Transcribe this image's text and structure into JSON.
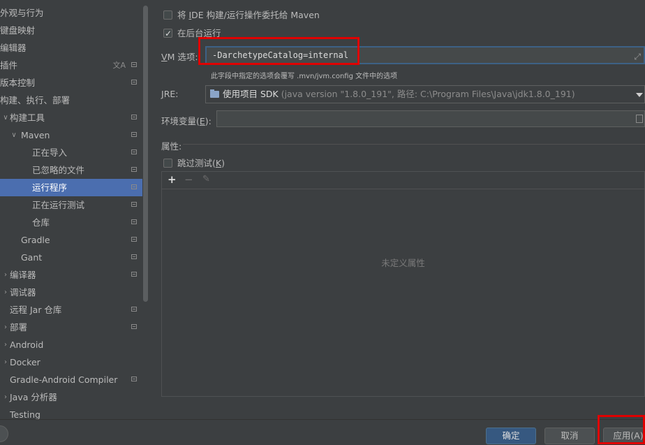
{
  "sidebar": {
    "items": [
      {
        "label": "外观与行为",
        "level": 0,
        "arrow": "",
        "proj": false
      },
      {
        "label": "键盘映射",
        "level": 0,
        "arrow": "",
        "proj": false
      },
      {
        "label": "编辑器",
        "level": 0,
        "arrow": "",
        "proj": false
      },
      {
        "label": "插件",
        "level": 0,
        "arrow": "",
        "proj": true,
        "translate": true
      },
      {
        "label": "版本控制",
        "level": 0,
        "arrow": "",
        "proj": true
      },
      {
        "label": "构建、执行、部署",
        "level": 0,
        "arrow": "",
        "proj": false
      },
      {
        "label": "构建工具",
        "level": 1,
        "arrow": "∨",
        "proj": true
      },
      {
        "label": "Maven",
        "level": 2,
        "arrow": "∨",
        "proj": true
      },
      {
        "label": "正在导入",
        "level": 3,
        "arrow": "",
        "proj": true
      },
      {
        "label": "已忽略的文件",
        "level": 3,
        "arrow": "",
        "proj": true
      },
      {
        "label": "运行程序",
        "level": 3,
        "arrow": "",
        "proj": true,
        "selected": true
      },
      {
        "label": "正在运行测试",
        "level": 3,
        "arrow": "",
        "proj": true
      },
      {
        "label": "仓库",
        "level": 3,
        "arrow": "",
        "proj": true
      },
      {
        "label": "Gradle",
        "level": 2,
        "arrow": "",
        "proj": true
      },
      {
        "label": "Gant",
        "level": 2,
        "arrow": "",
        "proj": true
      },
      {
        "label": "编译器",
        "level": 1,
        "arrow": "›",
        "proj": true
      },
      {
        "label": "调试器",
        "level": 1,
        "arrow": "›",
        "proj": false
      },
      {
        "label": "远程 Jar 仓库",
        "level": 1,
        "arrow": "",
        "proj": true
      },
      {
        "label": "部署",
        "level": 1,
        "arrow": "›",
        "proj": true
      },
      {
        "label": "Android",
        "level": 1,
        "arrow": "›",
        "proj": false
      },
      {
        "label": "Docker",
        "level": 1,
        "arrow": "›",
        "proj": false
      },
      {
        "label": "Gradle-Android Compiler",
        "level": 1,
        "arrow": "",
        "proj": true
      },
      {
        "label": "Java 分析器",
        "level": 1,
        "arrow": "›",
        "proj": false
      },
      {
        "label": "Testing",
        "level": 1,
        "arrow": "",
        "proj": false
      }
    ]
  },
  "runner": {
    "delegate_pre": "将 ",
    "delegate_mn": "I",
    "delegate_post": "DE 构建/运行操作委托给 Maven",
    "delegate_checked": false,
    "background_label": "在后台运行",
    "background_checked": true,
    "vm_label_mn": "V",
    "vm_label_rest": "M 选项:",
    "vm_value": "-DarchetypeCatalog=internal",
    "vm_hint": "此字段中指定的选项会覆写 .mvn/jvm.config 文件中的选项",
    "jre_label_mn": "J",
    "jre_label_rest": "RE:",
    "jre_main": "使用项目 SDK",
    "jre_detail": " (java version \"1.8.0_191\", 路径: C:\\Program Files\\Java\\jdk1.8.0_191)",
    "env_label_pre": "环境变量(",
    "env_label_mn": "E",
    "env_label_post": "):",
    "properties_label": "属性:",
    "skip_tests_pre": "跳过测试(",
    "skip_tests_mn": "K",
    "skip_tests_post": ")",
    "skip_tests_checked": false,
    "toolbar_add": "+",
    "toolbar_remove": "−",
    "toolbar_edit": "✎",
    "empty_text": "未定义属性"
  },
  "buttons": {
    "ok": "确定",
    "cancel": "取消",
    "apply": "应用(A)"
  },
  "colors": {
    "highlight_red": "#e00000",
    "selection_blue": "#4b6eaf"
  }
}
